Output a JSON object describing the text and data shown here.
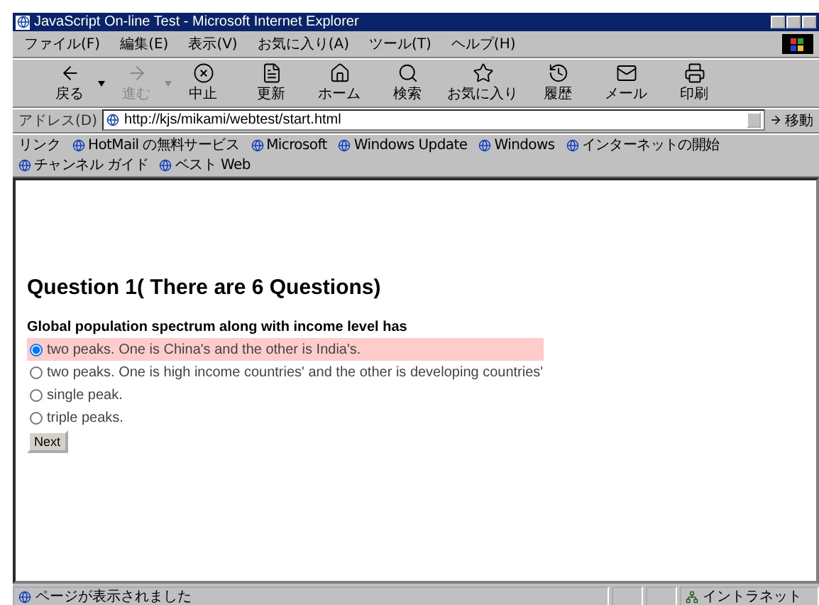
{
  "window": {
    "title": "JavaScript On-line Test - Microsoft Internet Explorer"
  },
  "menu": [
    "ファイル(F)",
    "編集(E)",
    "表示(V)",
    "お気に入り(A)",
    "ツール(T)",
    "ヘルプ(H)"
  ],
  "toolbar": [
    {
      "kind": "back",
      "label": "戻る",
      "disabled": false,
      "dropdown": true
    },
    {
      "kind": "forward",
      "label": "進む",
      "disabled": true,
      "dropdown": true
    },
    {
      "kind": "stop",
      "label": "中止",
      "disabled": false,
      "dropdown": false
    },
    {
      "kind": "refresh",
      "label": "更新",
      "disabled": false,
      "dropdown": false
    },
    {
      "kind": "home",
      "label": "ホーム",
      "disabled": false,
      "dropdown": false
    },
    {
      "kind": "search",
      "label": "検索",
      "disabled": false,
      "dropdown": false
    },
    {
      "kind": "favorites",
      "label": "お気に入り",
      "disabled": false,
      "dropdown": false
    },
    {
      "kind": "history",
      "label": "履歴",
      "disabled": false,
      "dropdown": false
    },
    {
      "kind": "mail",
      "label": "メール",
      "disabled": false,
      "dropdown": false
    },
    {
      "kind": "print",
      "label": "印刷",
      "disabled": false,
      "dropdown": false
    }
  ],
  "address": {
    "label": "アドレス(D)",
    "value": "http://kjs/mikami/webtest/start.html",
    "go": "移動"
  },
  "links": {
    "label": "リンク",
    "items": [
      "HotMail の無料サービス",
      "Microsoft",
      "Windows Update",
      "Windows",
      "インターネットの開始",
      "チャンネル ガイド",
      "ベスト Web"
    ]
  },
  "page": {
    "heading": "Question 1( There are 6 Questions)",
    "question": "Global population spectrum along with income level has",
    "options": [
      {
        "label": "two peaks. One is China's and the other is India's.",
        "selected": true
      },
      {
        "label": "two peaks. One is high income countries' and the other is developing countries'",
        "selected": false
      },
      {
        "label": "single peak.",
        "selected": false
      },
      {
        "label": "triple peaks.",
        "selected": false
      }
    ],
    "button": "Next"
  },
  "status_bar": {
    "message": "ページが表示されました",
    "zone": "イントラネット"
  }
}
